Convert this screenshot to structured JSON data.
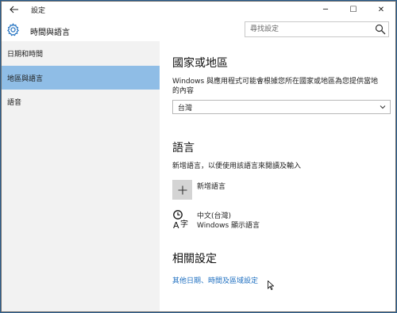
{
  "window": {
    "app_title": "設定",
    "controls": {
      "minimize": "─",
      "maximize": "☐",
      "close": "✕"
    }
  },
  "header": {
    "title": "時間與語言",
    "search_placeholder": "尋找設定"
  },
  "sidebar": {
    "items": [
      {
        "label": "日期和時間",
        "selected": false
      },
      {
        "label": "地區與語言",
        "selected": true
      },
      {
        "label": "語音",
        "selected": false
      }
    ]
  },
  "main": {
    "region": {
      "title": "國家或地區",
      "description_line1": "Windows 與應用程式可能會根據您所在國家或地區為您提供當地",
      "description_line2": "的內容",
      "selected_value": "台灣"
    },
    "language": {
      "title": "語言",
      "description": "新增語言，以便使用該語言來閱讀及輸入",
      "add_label": "新增語言",
      "installed": [
        {
          "name": "中文(台灣)",
          "subtitle": "Windows 顯示語言"
        }
      ]
    },
    "related": {
      "title": "相關設定",
      "link": "其他日期、時間及區域設定"
    }
  },
  "colors": {
    "accent_selected": "#8fbde6",
    "sidebar_bg": "#f2f2f2",
    "link": "#1e6fc0",
    "desktop": "#2b5f8f"
  }
}
